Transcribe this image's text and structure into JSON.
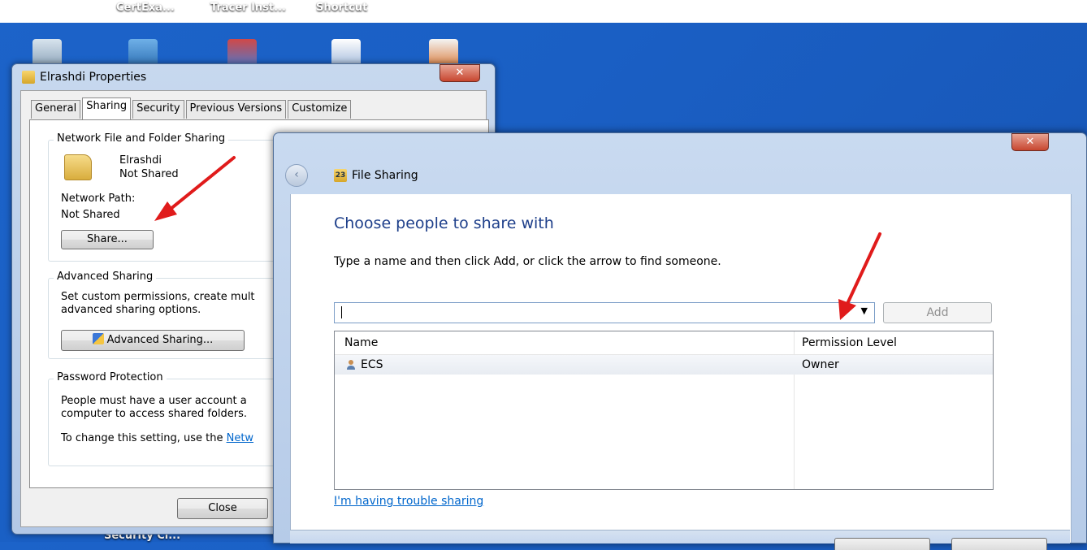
{
  "desktop": {
    "labels": [
      "CertExa...",
      "Tracer Inst...",
      "Shortcut"
    ],
    "bottom_label": "Security Cl..."
  },
  "properties_window": {
    "title": "Elrashdi Properties",
    "close_label": "✕",
    "tabs": [
      {
        "label": "General",
        "active": false
      },
      {
        "label": "Sharing",
        "active": true
      },
      {
        "label": "Security",
        "active": false
      },
      {
        "label": "Previous Versions",
        "active": false
      },
      {
        "label": "Customize",
        "active": false
      }
    ],
    "network_sharing": {
      "legend": "Network File and Folder Sharing",
      "folder_name": "Elrashdi",
      "folder_status": "Not Shared",
      "network_path_label": "Network Path:",
      "network_path_value": "Not Shared",
      "share_button": "Share..."
    },
    "advanced_sharing": {
      "legend": "Advanced Sharing",
      "line1": "Set custom permissions, create mult",
      "line2": "advanced sharing options.",
      "button": "Advanced Sharing..."
    },
    "password_protection": {
      "legend": "Password Protection",
      "line1": "People must have a user account a",
      "line2": "computer to access shared folders.",
      "line3_prefix": "To change this setting, use the ",
      "line3_link": "Netw"
    },
    "close_button": "Close"
  },
  "file_sharing_window": {
    "close_label": "✕",
    "back_icon": "‹",
    "title_icon_text": "23",
    "title": "File Sharing",
    "heading": "Choose people to share with",
    "instruction": "Type a name and then click Add, or click the arrow to find someone.",
    "input_value": "",
    "add_button": "Add",
    "columns": [
      "Name",
      "Permission Level"
    ],
    "rows": [
      {
        "name": "ECS",
        "permission": "Owner"
      }
    ],
    "trouble_link": "I'm having trouble sharing"
  },
  "colors": {
    "desktop_blue": "#1a5fc4",
    "annotation_arrow": "#e01b1b",
    "heading_blue": "#1e3f8a",
    "link_blue": "#0066cc"
  }
}
